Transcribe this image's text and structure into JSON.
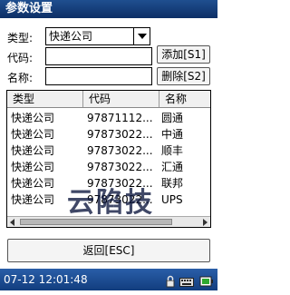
{
  "window": {
    "title": "参数设置"
  },
  "form": {
    "type_label": "类型:",
    "type_value": "快递公司",
    "code_label": "代码:",
    "code_value": "",
    "name_label": "名称:",
    "name_value": "",
    "add_button": "添加[S1]",
    "delete_button": "删除[S2]"
  },
  "table": {
    "columns": [
      "类型",
      "代码",
      "名称"
    ],
    "rows": [
      [
        "快递公司",
        "97871112...",
        "圆通"
      ],
      [
        "快递公司",
        "97873022...",
        "中通"
      ],
      [
        "快递公司",
        "97873022...",
        "顺丰"
      ],
      [
        "快递公司",
        "97873022...",
        "汇通"
      ],
      [
        "快递公司",
        "97873022...",
        "联邦"
      ],
      [
        "快递公司",
        "97873022...",
        "UPS"
      ]
    ]
  },
  "watermark": "云陷技",
  "back_button": "返回[ESC]",
  "taskbar": {
    "datetime": "07-12 12:01:48"
  }
}
